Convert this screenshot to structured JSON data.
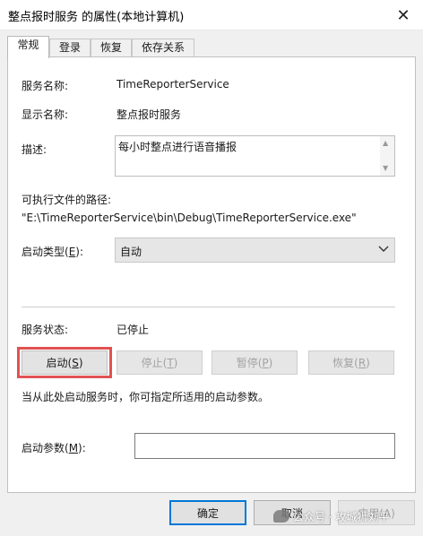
{
  "window": {
    "title": "整点报时服务 的属性(本地计算机)",
    "close_glyph": "✕"
  },
  "tabs": [
    {
      "label": "常规",
      "active": true
    },
    {
      "label": "登录"
    },
    {
      "label": "恢复"
    },
    {
      "label": "依存关系"
    }
  ],
  "general": {
    "service_name_label": "服务名称:",
    "service_name_value": "TimeReporterService",
    "display_name_label": "显示名称:",
    "display_name_value": "整点报时服务",
    "description_label": "描述:",
    "description_value": "每小时整点进行语音播报",
    "exe_path_label": "可执行文件的路径:",
    "exe_path_value": "\"E:\\TimeReporterService\\bin\\Debug\\TimeReporterService.exe\"",
    "startup_type_label_prefix": "启动类型(",
    "startup_type_label_key": "E",
    "startup_type_label_suffix": "):",
    "startup_type_value": "自动",
    "status_label": "服务状态:",
    "status_value": "已停止",
    "buttons": {
      "start": {
        "prefix": "启动(",
        "key": "S",
        "suffix": ")"
      },
      "stop": {
        "prefix": "停止(",
        "key": "T",
        "suffix": ")"
      },
      "pause": {
        "prefix": "暂停(",
        "key": "P",
        "suffix": ")"
      },
      "resume": {
        "prefix": "恢复(",
        "key": "R",
        "suffix": ")"
      }
    },
    "hint": "当从此处启动服务时，你可指定所适用的启动参数。",
    "params_label_prefix": "启动参数(",
    "params_label_key": "M",
    "params_label_suffix": "):",
    "params_value": ""
  },
  "footer": {
    "ok": "确定",
    "cancel": "取消",
    "apply": "应用(A)"
  },
  "watermark": {
    "text": "公众号 · 攻城狮刘平"
  },
  "colors": {
    "highlight": "#e05252",
    "default_button_border": "#0078d7"
  }
}
